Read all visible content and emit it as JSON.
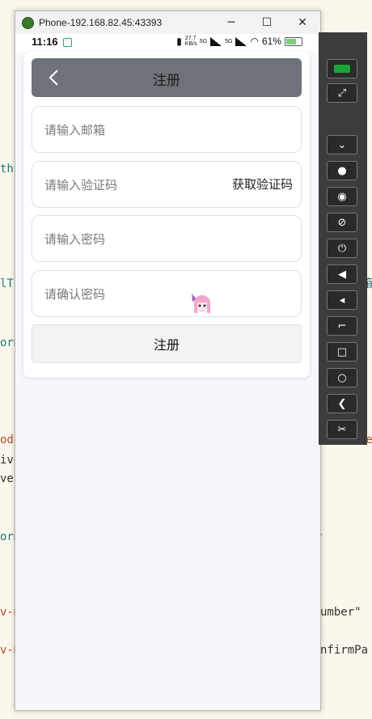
{
  "background_code": [
    {
      "text": "thF",
      "color": "#1f7a7a"
    },
    {
      "text": "lT",
      "color": "#1f7a7a"
    },
    {
      "text": "orm",
      "color": "#1f7a7a"
    },
    {
      "text": "ode",
      "color": "#b5472b"
    },
    {
      "text": "ive",
      "color": "#333333"
    },
    {
      "text": "ve'",
      "color": "#333333"
    },
    {
      "text": "orm",
      "color": "#1f7a7a"
    },
    {
      "text": "v-m",
      "color": "#b5472b"
    },
    {
      "text": "v-m",
      "color": "#b5472b"
    },
    {
      "text": "umber\"",
      "color": "#333333"
    },
    {
      "text": "nfirmPa",
      "color": "#333333"
    },
    {
      "text": "de",
      "color": "#b5472b"
    },
    {
      "text": "箱",
      "color": "#1f7a7a"
    }
  ],
  "window": {
    "title": "Phone-192.168.82.45:43393",
    "minimize": "─",
    "maximize": "☐",
    "close": "✕"
  },
  "statusbar": {
    "time": "11:16",
    "speed": "27.7 KB/s",
    "net1": "5G",
    "net2": "5G",
    "battery": "61%"
  },
  "header": {
    "title": "注册",
    "back_icon": "chevron-left-icon"
  },
  "form": {
    "email_placeholder": "请输入邮箱",
    "code_placeholder": "请输入验证码",
    "get_code_label": "获取验证码",
    "password_placeholder": "请输入密码",
    "confirm_placeholder": "请确认密码",
    "submit_label": "注册"
  },
  "toolbar_icons": [
    "phone-icon",
    "fullscreen-icon",
    "collapse-icon",
    "record-icon",
    "show-icon",
    "hide-icon",
    "power-icon",
    "volume-up-icon",
    "volume-down-icon",
    "rotate-icon",
    "home-icon",
    "recent-icon",
    "back-icon",
    "screenshot-icon"
  ],
  "colors": {
    "header_bg": "#6d7379",
    "accent_status": "#29a37a",
    "toolbar_bg": "#3c3c3c"
  }
}
